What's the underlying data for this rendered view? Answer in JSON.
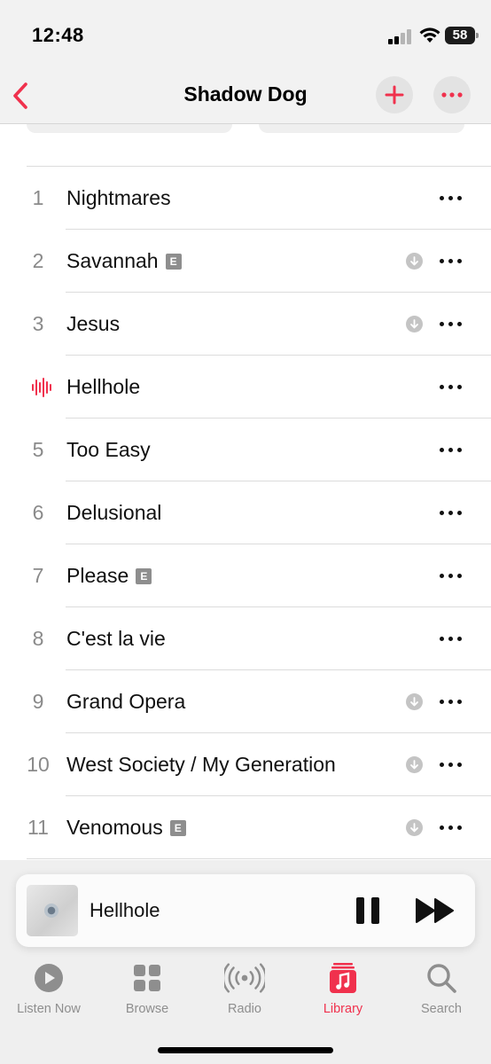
{
  "status_bar": {
    "time": "12:48",
    "battery": "58"
  },
  "nav": {
    "title": "Shadow Dog"
  },
  "colors": {
    "accent": "#f0314d",
    "secondary_text": "#8a8a8a"
  },
  "tracks": [
    {
      "number": "1",
      "title": "Nightmares",
      "explicit": false,
      "downloadable": false,
      "playing": false
    },
    {
      "number": "2",
      "title": "Savannah",
      "explicit": true,
      "downloadable": true,
      "playing": false
    },
    {
      "number": "3",
      "title": "Jesus",
      "explicit": false,
      "downloadable": true,
      "playing": false
    },
    {
      "number": "4",
      "title": "Hellhole",
      "explicit": false,
      "downloadable": false,
      "playing": true
    },
    {
      "number": "5",
      "title": "Too Easy",
      "explicit": false,
      "downloadable": false,
      "playing": false
    },
    {
      "number": "6",
      "title": "Delusional",
      "explicit": false,
      "downloadable": false,
      "playing": false
    },
    {
      "number": "7",
      "title": "Please",
      "explicit": true,
      "downloadable": false,
      "playing": false
    },
    {
      "number": "8",
      "title": "C'est la vie",
      "explicit": false,
      "downloadable": false,
      "playing": false
    },
    {
      "number": "9",
      "title": "Grand Opera",
      "explicit": false,
      "downloadable": true,
      "playing": false
    },
    {
      "number": "10",
      "title": "West Society / My Generation",
      "explicit": false,
      "downloadable": true,
      "playing": false
    },
    {
      "number": "11",
      "title": "Venomous",
      "explicit": true,
      "downloadable": true,
      "playing": false
    }
  ],
  "explicit_badge": "E",
  "mini_player": {
    "title": "Hellhole",
    "state": "playing"
  },
  "tabs": [
    {
      "label": "Listen Now",
      "icon": "play-circle-icon",
      "active": false
    },
    {
      "label": "Browse",
      "icon": "grid-icon",
      "active": false
    },
    {
      "label": "Radio",
      "icon": "radio-waves-icon",
      "active": false
    },
    {
      "label": "Library",
      "icon": "music-note-icon",
      "active": true
    },
    {
      "label": "Search",
      "icon": "magnifier-icon",
      "active": false
    }
  ]
}
